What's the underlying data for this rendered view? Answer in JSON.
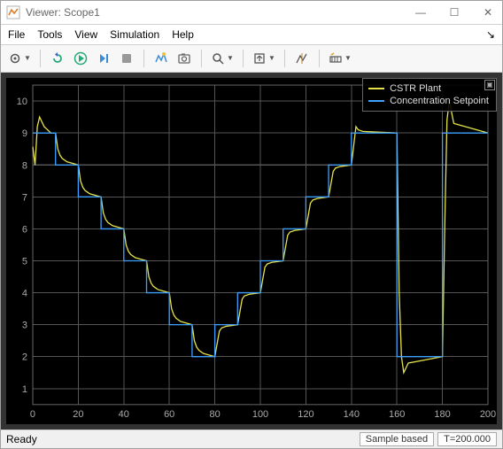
{
  "window": {
    "title": "Viewer: Scope1"
  },
  "menubar": {
    "items": [
      "File",
      "Tools",
      "View",
      "Simulation",
      "Help"
    ]
  },
  "toolbar": {
    "buttons": [
      {
        "name": "config-gear-icon",
        "dropdown": true
      },
      {
        "name": "sep"
      },
      {
        "name": "restart-icon"
      },
      {
        "name": "run-icon"
      },
      {
        "name": "step-forward-icon"
      },
      {
        "name": "stop-icon"
      },
      {
        "name": "sep"
      },
      {
        "name": "highlight-signal-icon"
      },
      {
        "name": "snapshot-icon"
      },
      {
        "name": "sep"
      },
      {
        "name": "zoom-icon",
        "dropdown": true
      },
      {
        "name": "sep"
      },
      {
        "name": "autoscale-icon",
        "dropdown": true
      },
      {
        "name": "sep"
      },
      {
        "name": "cursor-measure-icon"
      },
      {
        "name": "sep"
      },
      {
        "name": "triggers-icon",
        "dropdown": true
      }
    ]
  },
  "statusbar": {
    "ready": "Ready",
    "mode": "Sample based",
    "time": "T=200.000"
  },
  "chart_data": {
    "type": "line",
    "xlabel": "",
    "ylabel": "",
    "xlim": [
      0,
      200
    ],
    "ylim": [
      0.5,
      10.5
    ],
    "xticks": [
      0,
      20,
      40,
      60,
      80,
      100,
      120,
      140,
      160,
      180,
      200
    ],
    "yticks": [
      1,
      2,
      3,
      4,
      5,
      6,
      7,
      8,
      9,
      10
    ],
    "legend_position": "top-right",
    "series": [
      {
        "name": "CSTR Plant",
        "color": "#e6e24a",
        "x": [
          0,
          1,
          2,
          3,
          5,
          8,
          10,
          11,
          12,
          13,
          15,
          20,
          21,
          22,
          23,
          25,
          30,
          31,
          32,
          33,
          35,
          40,
          41,
          42,
          43,
          45,
          50,
          51,
          52,
          53,
          55,
          60,
          61,
          62,
          63,
          65,
          70,
          71,
          72,
          73,
          75,
          80,
          81,
          82,
          83,
          85,
          90,
          91,
          92,
          93,
          95,
          100,
          101,
          102,
          103,
          105,
          110,
          111,
          112,
          113,
          115,
          120,
          121,
          122,
          123,
          125,
          130,
          131,
          132,
          133,
          135,
          140,
          141,
          142,
          143,
          145,
          160,
          161,
          162,
          163,
          165,
          180,
          181,
          182,
          183,
          185,
          200
        ],
        "y": [
          8.57,
          8.0,
          9.2,
          9.5,
          9.2,
          9.0,
          9.0,
          8.5,
          8.3,
          8.2,
          8.1,
          8.0,
          7.5,
          7.3,
          7.2,
          7.1,
          7.0,
          6.5,
          6.3,
          6.2,
          6.1,
          6.0,
          5.5,
          5.3,
          5.2,
          5.1,
          5.0,
          4.5,
          4.3,
          4.2,
          4.1,
          4.0,
          3.5,
          3.3,
          3.2,
          3.1,
          3.0,
          2.5,
          2.3,
          2.2,
          2.1,
          2.0,
          2.4,
          2.8,
          2.9,
          2.95,
          3.0,
          3.4,
          3.8,
          3.9,
          3.95,
          4.0,
          4.4,
          4.8,
          4.9,
          4.95,
          5.0,
          5.4,
          5.8,
          5.9,
          5.95,
          6.0,
          6.4,
          6.8,
          6.9,
          6.95,
          7.0,
          7.4,
          7.8,
          7.9,
          7.95,
          8.0,
          8.6,
          9.2,
          9.1,
          9.05,
          9.0,
          4.0,
          2.0,
          1.5,
          1.8,
          2.0,
          6.0,
          9.4,
          10.0,
          9.3,
          9.0
        ]
      },
      {
        "name": "Concentration Setpoint",
        "color": "#3fa0ff",
        "x": [
          0,
          10,
          10,
          20,
          20,
          30,
          30,
          40,
          40,
          50,
          50,
          60,
          60,
          70,
          70,
          80,
          80,
          90,
          90,
          100,
          100,
          110,
          110,
          120,
          120,
          130,
          130,
          140,
          140,
          160,
          160,
          180,
          180,
          200
        ],
        "y": [
          9,
          9,
          8,
          8,
          7,
          7,
          6,
          6,
          5,
          5,
          4,
          4,
          3,
          3,
          2,
          2,
          3,
          3,
          4,
          4,
          5,
          5,
          6,
          6,
          7,
          7,
          8,
          8,
          9,
          9,
          2,
          2,
          9,
          9
        ]
      }
    ]
  }
}
